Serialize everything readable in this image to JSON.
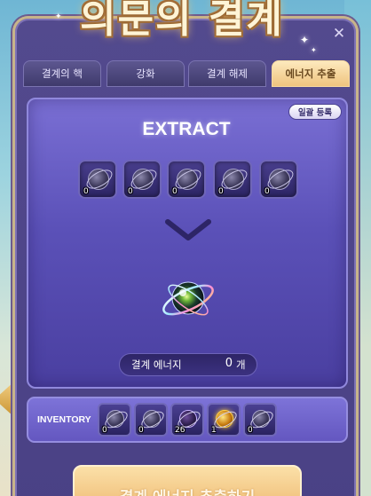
{
  "title": "의문의 결계",
  "tabs": [
    {
      "label": "결계의 핵",
      "active": false
    },
    {
      "label": "강화",
      "active": false
    },
    {
      "label": "결계 해제",
      "active": false
    },
    {
      "label": "에너지 추출",
      "active": true
    }
  ],
  "close_icon": "close-icon",
  "panel": {
    "bulk_register_label": "일괄 등록",
    "heading": "EXTRACT",
    "slots": [
      {
        "count": "0",
        "icon": "barrier-core-icon"
      },
      {
        "count": "0",
        "icon": "barrier-core-icon"
      },
      {
        "count": "0",
        "icon": "barrier-core-icon"
      },
      {
        "count": "0",
        "icon": "barrier-core-icon"
      },
      {
        "count": "0",
        "icon": "barrier-core-icon"
      }
    ],
    "arrow_icon": "chevron-down-icon",
    "result_icon": "energy-orb-icon",
    "energy_label": "결계 에너지",
    "energy_value": "0",
    "energy_unit": "개"
  },
  "inventory": {
    "label": "INVENTORY",
    "items": [
      {
        "count": "0",
        "icon": "barrier-core-icon"
      },
      {
        "count": "0",
        "icon": "barrier-core-icon"
      },
      {
        "count": "26",
        "icon": "dark-core-icon"
      },
      {
        "count": "1",
        "icon": "gold-core-icon"
      },
      {
        "count": "0",
        "icon": "barrier-core-icon"
      }
    ]
  },
  "extract_button_label": "결계 에너지 추출하기",
  "colors": {
    "window_bg": "#4e4589",
    "panel_bg": "#6a5fc8",
    "active_tab": "#f3cf8f",
    "button_gold": "#f4c987"
  }
}
